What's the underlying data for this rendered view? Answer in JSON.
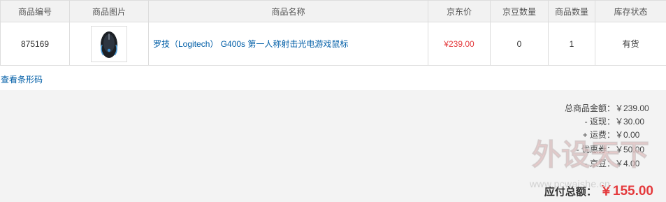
{
  "table": {
    "headers": [
      "商品编号",
      "商品图片",
      "商品名称",
      "京东价",
      "京豆数量",
      "商品数量",
      "库存状态"
    ],
    "rows": [
      {
        "id": "875169",
        "image_icon": "gaming-mouse-icon",
        "name": "罗技（Logitech） G400s 第一人称射击光电游戏鼠标",
        "price": "¥239.00",
        "beans": "0",
        "quantity": "1",
        "stock": "有货"
      }
    ]
  },
  "barcode_link": "查看条形码",
  "summary": {
    "goods_total_label": "总商品金额：",
    "goods_total": "￥239.00",
    "rebate_label": "- 返现：",
    "rebate": "￥30.00",
    "shipping_label": "+ 运费：",
    "shipping": "￥0.00",
    "coupon_label": "- 优惠券：",
    "coupon": "￥50.00",
    "beans_label": "- 京豆：",
    "beans": "￥4.00",
    "total_label": "应付总额：",
    "total": "￥155.00"
  },
  "watermark": {
    "logo_text": "外设天下",
    "url": "www.pcwaishe.cn"
  },
  "colors": {
    "price_red": "#e4393c",
    "link_blue": "#005ea7",
    "header_bg": "#f2f2f2",
    "summary_bg": "#f3f3f3",
    "border": "#dddddd"
  }
}
